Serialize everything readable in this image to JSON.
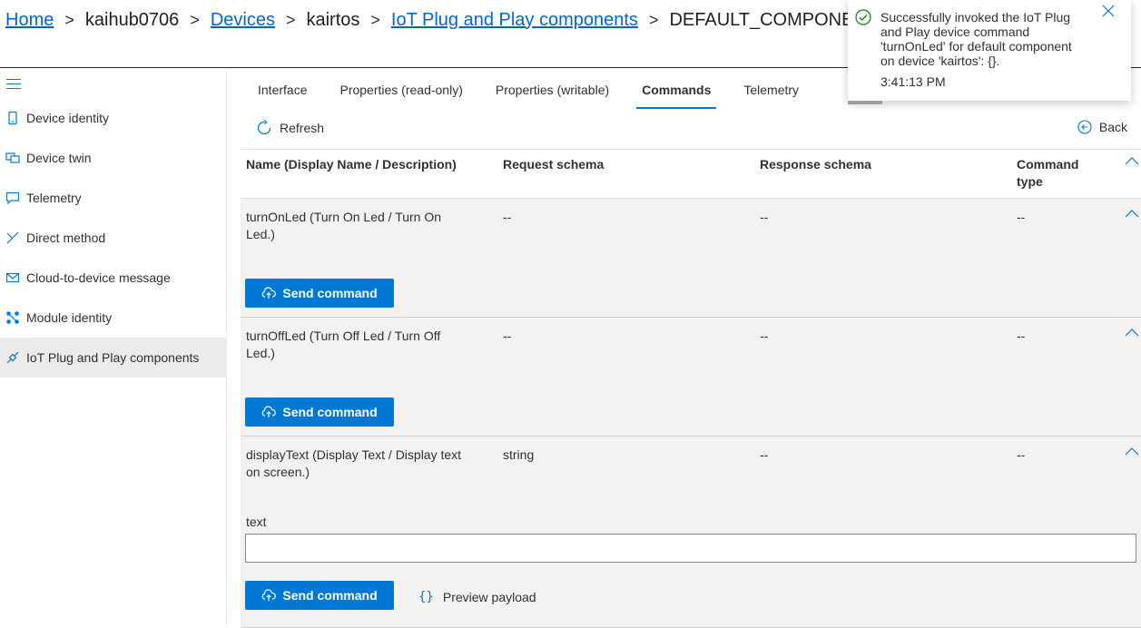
{
  "breadcrumb": {
    "home": "Home",
    "hub": "kaihub0706",
    "devices": "Devices",
    "device": "kairtos",
    "pnp": "IoT Plug and Play components",
    "component": "DEFAULT_COMPONENT"
  },
  "sidebar": {
    "items": [
      {
        "label": "Device identity",
        "icon": "device-identity-icon"
      },
      {
        "label": "Device twin",
        "icon": "device-twin-icon"
      },
      {
        "label": "Telemetry",
        "icon": "telemetry-icon"
      },
      {
        "label": "Direct method",
        "icon": "direct-method-icon"
      },
      {
        "label": "Cloud-to-device message",
        "icon": "message-icon"
      },
      {
        "label": "Module identity",
        "icon": "module-identity-icon"
      },
      {
        "label": "IoT Plug and Play components",
        "icon": "plug-icon"
      }
    ],
    "active_index": 6
  },
  "tabs": [
    "Interface",
    "Properties (read-only)",
    "Properties (writable)",
    "Commands",
    "Telemetry"
  ],
  "active_tab": "Commands",
  "toolbar": {
    "refresh": "Refresh",
    "back": "Back"
  },
  "table": {
    "headers": {
      "name": "Name (Display Name / Description)",
      "request": "Request schema",
      "response": "Response schema",
      "type": "Command type"
    },
    "rows": [
      {
        "name": "turnOnLed (Turn On Led / Turn On Led.)",
        "request": "--",
        "response": "--",
        "type": "--",
        "button": "Send command"
      },
      {
        "name": "turnOffLed (Turn Off Led / Turn Off Led.)",
        "request": "--",
        "response": "--",
        "type": "--",
        "button": "Send command"
      },
      {
        "name": "displayText (Display Text / Display text on screen.)",
        "request": "string",
        "response": "--",
        "type": "--",
        "field_label": "text",
        "field_value": "",
        "button": "Send command",
        "preview": "Preview payload"
      }
    ]
  },
  "toast": {
    "message": "Successfully invoked the IoT Plug and Play device command 'turnOnLed' for default component on device 'kairtos': {}.",
    "time": "3:41:13 PM"
  },
  "colors": {
    "accent": "#0078d4",
    "success": "#107c10",
    "row_bg": "#f3f2f1"
  }
}
